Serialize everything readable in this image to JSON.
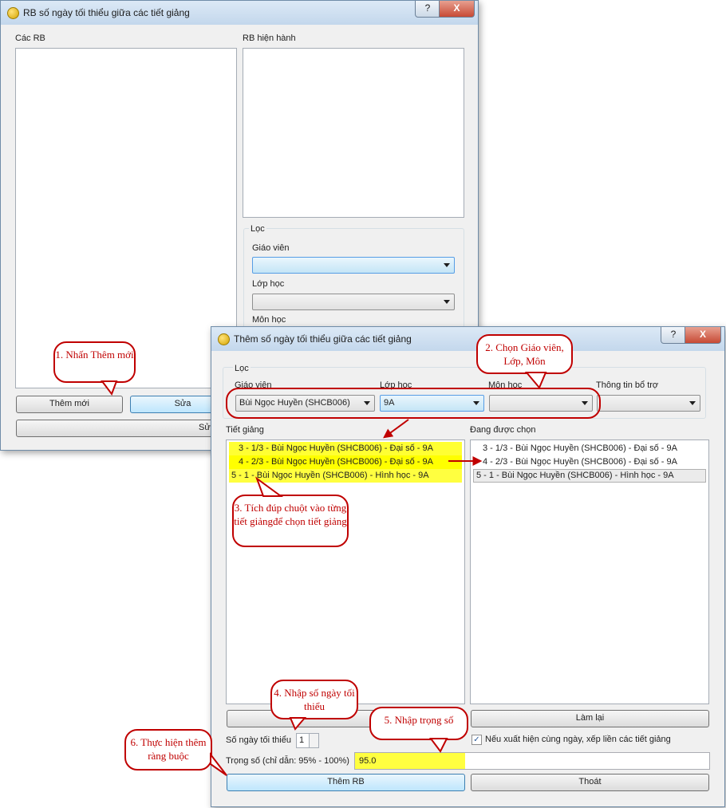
{
  "back_window": {
    "title": "RB số ngày tối thiểu giữa các tiết giảng",
    "help_label": "?",
    "close_label": "X",
    "list_left_label": "Các RB",
    "list_right_label": "RB hiện hành",
    "filter_group": "Lọc",
    "filter_teacher_label": "Giáo viên",
    "filter_class_label": "Lớp học",
    "filter_subject_label": "Môn học",
    "btn_add": "Thêm mới",
    "btn_edit": "Sửa",
    "btn_wide": "Sửa"
  },
  "front_window": {
    "title": "Thêm số ngày tối thiểu giữa các tiết giảng",
    "help_label": "?",
    "close_label": "X",
    "filter_group": "Lọc",
    "teacher_label": "Giáo viên",
    "teacher_value": "Bùi Ngọc Huyền (SHCB006)",
    "class_label": "Lớp học",
    "class_value": "9A",
    "subject_label": "Môn học",
    "subject_value": "",
    "extra_label": "Thông tin bổ trợ",
    "extra_value": "",
    "lessons_label": "Tiết giảng",
    "lessons": [
      "3 - 1/3 - Bùi Ngọc Huyền (SHCB006) - Đại số - 9A",
      "4 - 2/3 - Bùi Ngọc Huyền (SHCB006) - Đại số - 9A",
      "5 - 1 - Bùi Ngọc Huyền (SHCB006) - Hình học - 9A"
    ],
    "selected_label": "Đang được chọn",
    "selected": [
      "3 - 1/3 - Bùi Ngọc Huyền (SHCB006) - Đại số - 9A",
      "4 - 2/3 - Bùi Ngọc Huyền (SHCB006) - Đại số - 9A",
      "5 - 1 - Bùi Ngọc Huyền (SHCB006) - Hình học - 9A"
    ],
    "btn_left": "",
    "btn_reset": "Làm lại",
    "min_days_label": "Số ngày tối thiểu",
    "min_days_value": "1",
    "same_day_checked": true,
    "same_day_check_mark": "✓",
    "same_day_label": "Nếu xuất hiện cùng ngày, xếp liền các tiết giảng",
    "weight_label": "Trọng số (chỉ dẫn: 95% - 100%)",
    "weight_value": "95.0",
    "btn_add_rb": "Thêm RB",
    "btn_exit": "Thoát"
  },
  "callouts": {
    "c1": "1. Nhấn Thêm mới",
    "c2": "2. Chọn Giáo viên, Lớp, Môn",
    "c3": "3. Tích đúp chuột vào từng tiết giảngđể chọn tiết giảng",
    "c4": "4. Nhập số ngày tối thiểu",
    "c5": "5. Nhập trọng số",
    "c6": "6. Thực hiện thêm ràng buộc"
  },
  "colors": {
    "annotation_red": "#c00000",
    "highlight_yellow": "#ffff33"
  }
}
